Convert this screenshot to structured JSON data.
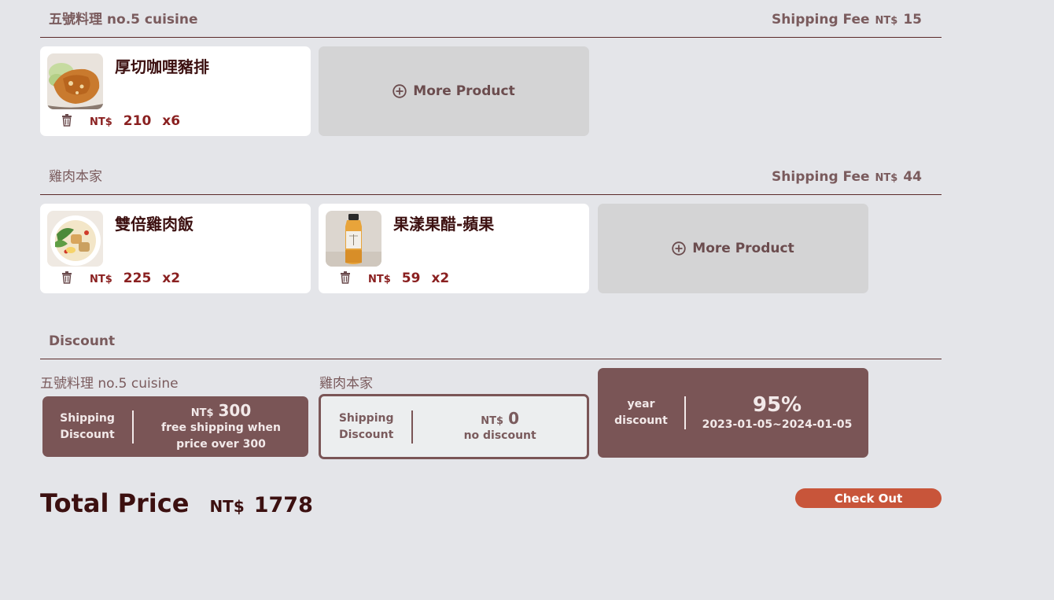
{
  "stores": [
    {
      "name": "五號料理 no.5 cuisine",
      "shipping_label": "Shipping Fee",
      "currency": "NT$",
      "shipping_fee": "15",
      "products": [
        {
          "name": "厚切咖哩豬排",
          "currency": "NT$",
          "price": "210",
          "qty": "x6",
          "image": "curry-pork-cutlet-photo"
        }
      ],
      "more_label": "More Product"
    },
    {
      "name": "雞肉本家",
      "shipping_label": "Shipping Fee",
      "currency": "NT$",
      "shipping_fee": "44",
      "products": [
        {
          "name": "雙倍雞肉飯",
          "currency": "NT$",
          "price": "225",
          "qty": "x2",
          "image": "chicken-rice-bowl-photo"
        },
        {
          "name": "果漾果醋-蘋果",
          "currency": "NT$",
          "price": "59",
          "qty": "x2",
          "image": "vinegar-bottle-photo"
        }
      ],
      "more_label": "More Product"
    }
  ],
  "discount": {
    "title": "Discount",
    "items": [
      {
        "store": "五號料理 no.5 cuisine",
        "type_line1": "Shipping",
        "type_line2": "Discount",
        "currency": "NT$",
        "amount": "300",
        "note": "free shipping when price over 300",
        "style": "filled"
      },
      {
        "store": "雞肉本家",
        "type_line1": "Shipping",
        "type_line2": "Discount",
        "currency": "NT$",
        "amount": "0",
        "note": "no discount",
        "style": "outline"
      },
      {
        "type_line1": "year",
        "type_line2": "discount",
        "percent": "95%",
        "period": "2023-01-05~2024-01-05",
        "style": "filled"
      }
    ]
  },
  "total": {
    "label": "Total Price",
    "currency": "NT$",
    "value": "1778"
  },
  "checkout_label": "Check Out",
  "colors": {
    "background": "#e4e5e9",
    "accent": "#c8553a",
    "discount_fill": "#7a5556",
    "text_dark": "#3c1010",
    "price_red": "#8a2020"
  }
}
